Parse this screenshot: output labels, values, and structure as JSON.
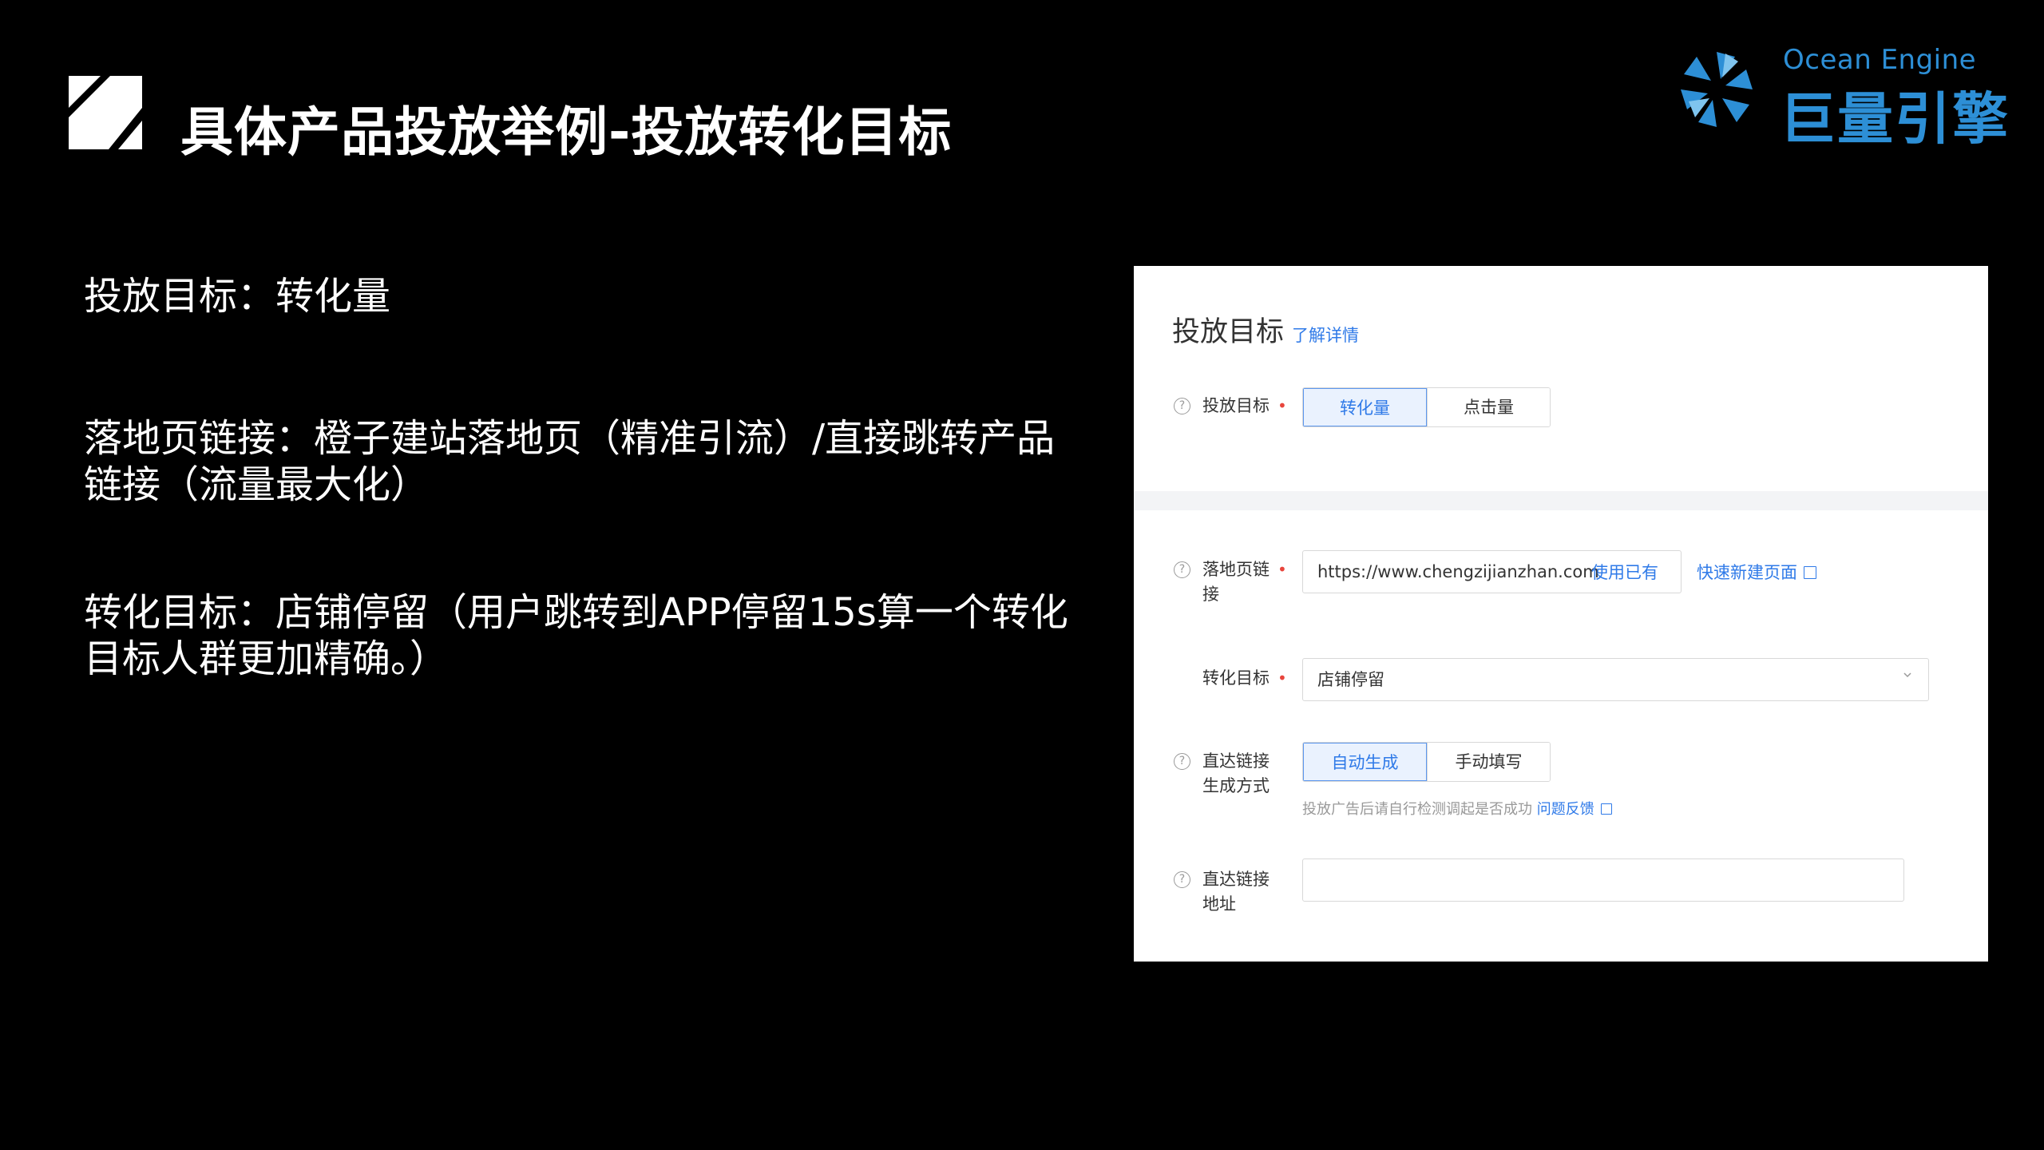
{
  "slide": {
    "title": "具体产品投放举例-投放转化目标",
    "brand_en": "Ocean Engine",
    "brand_cn": "巨量引擎",
    "bullets": [
      "投放目标：转化量",
      "落地页链接：橙子建站落地页（精准引流）/直接跳转产品链接（流量最大化）",
      "转化目标：店铺停留（用户跳转到APP停留15s算一个转化目标人群更加精确。）"
    ]
  },
  "form": {
    "heading": "投放目标",
    "heading_link": "了解详情",
    "goal": {
      "label": "投放目标",
      "options": [
        "转化量",
        "点击量"
      ],
      "selected": "转化量"
    },
    "landing": {
      "label_line1": "落地页链",
      "label_line2": "接",
      "value": "https://www.chengzijianzhan.com",
      "use_existing": "使用已有",
      "quick_create": "快速新建页面"
    },
    "conversion": {
      "label": "转化目标",
      "selected": "店铺停留"
    },
    "deeplink_mode": {
      "label_line1": "直达链接",
      "label_line2": "生成方式",
      "options": [
        "自动生成",
        "手动填写"
      ],
      "selected": "自动生成",
      "hint": "投放广告后请自行检测调起是否成功",
      "feedback_link": "问题反馈"
    },
    "deeplink_url": {
      "label_line1": "直达链接",
      "label_line2": "地址",
      "value": ""
    }
  },
  "colors": {
    "accent_blue": "#2f7ae8",
    "brand_blue": "#2d8fd6",
    "required_red": "#e8453c"
  }
}
